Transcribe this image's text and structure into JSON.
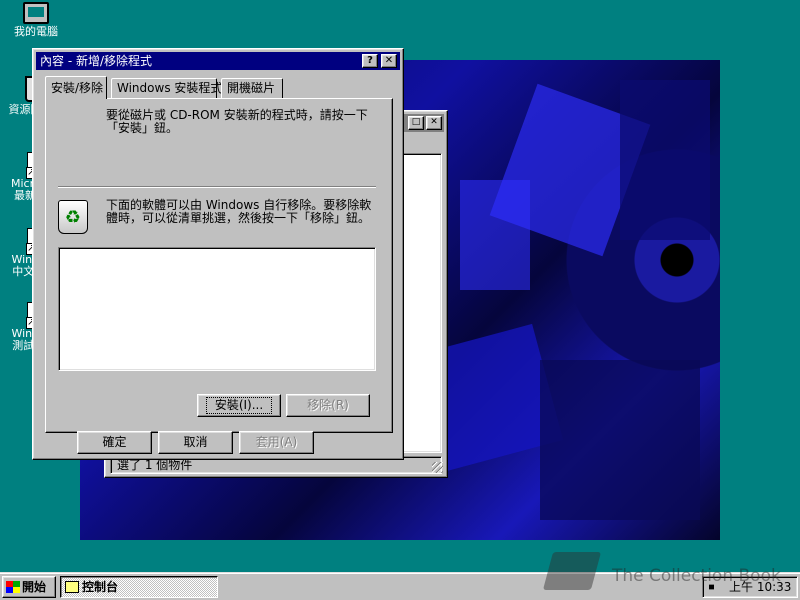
{
  "desktop": {
    "icons": [
      {
        "label": "我的電腦",
        "icon": "computer-icon"
      },
      {
        "label": "資源回收筒",
        "icon": "recycle-bin-icon"
      },
      {
        "label": "Microsoft 最新消息",
        "icon": "document-shortcut-icon"
      },
      {
        "label": "Windows 中文版 事",
        "icon": "document-shortcut-icon"
      },
      {
        "label": "Windows 測試版 事",
        "icon": "document-shortcut-icon"
      }
    ]
  },
  "control_panel_window": {
    "status_text": "選了 1 個物件"
  },
  "dialog": {
    "title": "內容 - 新增/移除程式",
    "help_button": "?",
    "close_button": "✕",
    "tabs": [
      {
        "label": "安裝/移除",
        "active": true
      },
      {
        "label": "Windows 安裝程式",
        "active": false
      },
      {
        "label": "開機磁片",
        "active": false
      }
    ],
    "install_text": "要從磁片或 CD-ROM 安裝新的程式時，請按一下「安裝」鈕。",
    "remove_text": "下面的軟體可以由 Windows 自行移除。要移除軟體時，可以從清單挑選，然後按一下「移除」鈕。",
    "install_button": "安裝(I)...",
    "remove_button": "移除(R)",
    "ok_button": "確定",
    "cancel_button": "取消",
    "apply_button": "套用(A)"
  },
  "taskbar": {
    "start_label": "開始",
    "task_label": "控制台",
    "clock": "上午 10:33"
  },
  "watermark": {
    "text": "The Collection Book"
  },
  "colors": {
    "desktop": "#008080",
    "titlebar_active": "#000080",
    "titlebar_inactive": "#808080",
    "face": "#c0c0c0"
  }
}
